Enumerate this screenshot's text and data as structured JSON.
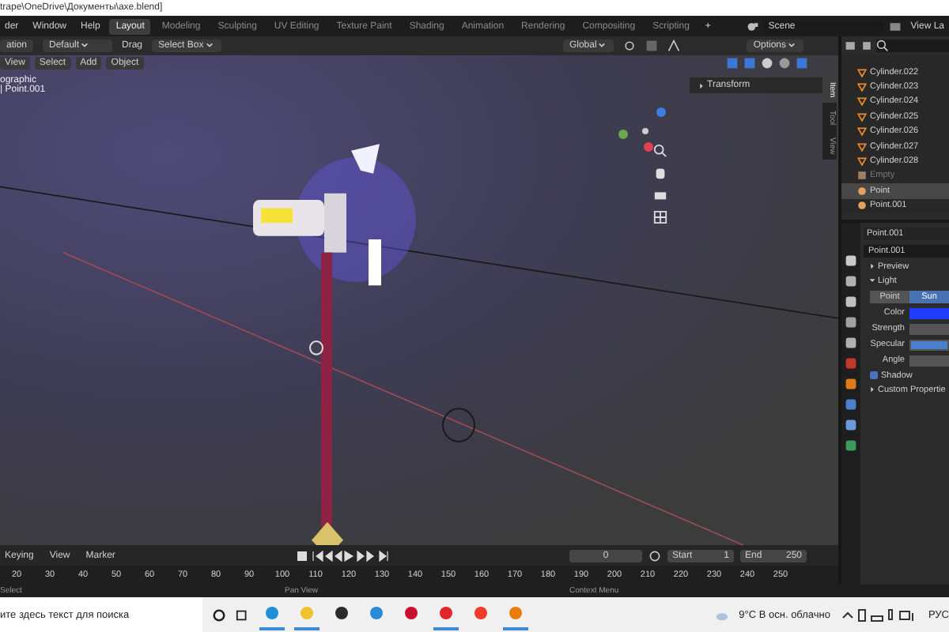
{
  "title_bar": {
    "path": "trape\\OneDrive\\Документы\\axe.blend]"
  },
  "menu": [
    "der",
    "Window",
    "Help"
  ],
  "workspaces": [
    {
      "label": "Layout",
      "selected": true
    },
    {
      "label": "Modeling",
      "selected": false
    },
    {
      "label": "Sculpting",
      "selected": false
    },
    {
      "label": "UV Editing",
      "selected": false
    },
    {
      "label": "Texture Paint",
      "selected": false
    },
    {
      "label": "Shading",
      "selected": false
    },
    {
      "label": "Animation",
      "selected": false
    },
    {
      "label": "Rendering",
      "selected": false
    },
    {
      "label": "Compositing",
      "selected": false
    },
    {
      "label": "Scripting",
      "selected": false
    }
  ],
  "add_workspace": "+",
  "scene": "Scene",
  "view_layer": "View La",
  "tool_header": {
    "mode": "ation",
    "orientation": "Default",
    "drag_label": "Drag",
    "select": "Select Box",
    "transform": "Global",
    "options": "Options"
  },
  "viewport": {
    "menus": [
      "View",
      "Select",
      "Add",
      "Object"
    ],
    "overlay_lines": [
      "ographic",
      "| Point.001"
    ],
    "panel_title": "Transform",
    "sidebar_tabs": [
      {
        "label": "Item",
        "selected": true
      },
      {
        "label": "Tool",
        "selected": false
      },
      {
        "label": "View",
        "selected": false
      }
    ]
  },
  "outliner": {
    "rows": [
      {
        "name": "Cylinder.022",
        "kind": "mesh",
        "selected": false
      },
      {
        "name": "Cylinder.023",
        "kind": "mesh",
        "selected": false
      },
      {
        "name": "Cylinder.024",
        "kind": "mesh",
        "selected": false
      },
      {
        "name": "Cylinder.025",
        "kind": "mesh",
        "selected": false
      },
      {
        "name": "Cylinder.026",
        "kind": "mesh",
        "selected": false
      },
      {
        "name": "Cylinder.027",
        "kind": "mesh",
        "selected": false
      },
      {
        "name": "Cylinder.028",
        "kind": "mesh",
        "selected": false
      },
      {
        "name": "Empty",
        "kind": "empty",
        "selected": false
      },
      {
        "name": "Point",
        "kind": "light",
        "selected": true
      },
      {
        "name": "Point.001",
        "kind": "light",
        "selected": false
      }
    ]
  },
  "properties": {
    "object": "Point.001",
    "data_block": "Point.001",
    "preview": "Preview",
    "light": "Light",
    "types": [
      {
        "label": "Point",
        "selected": false
      },
      {
        "label": "Sun",
        "selected": true
      }
    ],
    "fields": [
      {
        "label": "Color",
        "kind": "swatch"
      },
      {
        "label": "Strength",
        "kind": "number"
      },
      {
        "label": "Specular",
        "kind": "slider",
        "level": 1
      },
      {
        "label": "Angle",
        "kind": "number"
      }
    ],
    "shadow": {
      "label": "Shadow",
      "checked": true
    },
    "custom": "Custom Propertie"
  },
  "timeline": {
    "menus": [
      "Keying",
      "View",
      "Marker"
    ],
    "frame": "0",
    "start_label": "Start",
    "start": "1",
    "end_label": "End",
    "end": "250",
    "ruler": [
      "20",
      "30",
      "40",
      "50",
      "60",
      "70",
      "80",
      "90",
      "100",
      "110",
      "120",
      "130",
      "140",
      "150",
      "160",
      "170",
      "180",
      "190",
      "200",
      "210",
      "220",
      "230",
      "240",
      "250"
    ]
  },
  "status_bar": [
    "Select",
    "Pan View",
    "Context Menu"
  ],
  "taskbar": {
    "search": "ите здесь текст для поиска",
    "weather": "9°C  В осн. облачно",
    "language": "РУС",
    "apps": [
      {
        "kind": "browser",
        "running": true
      },
      {
        "kind": "folder",
        "running": true
      },
      {
        "kind": "store",
        "running": false
      },
      {
        "kind": "mail",
        "running": false
      },
      {
        "kind": "shield",
        "running": false
      },
      {
        "kind": "letter-y",
        "running": true
      },
      {
        "kind": "circle-y",
        "running": false
      },
      {
        "kind": "blender",
        "running": true
      }
    ]
  }
}
